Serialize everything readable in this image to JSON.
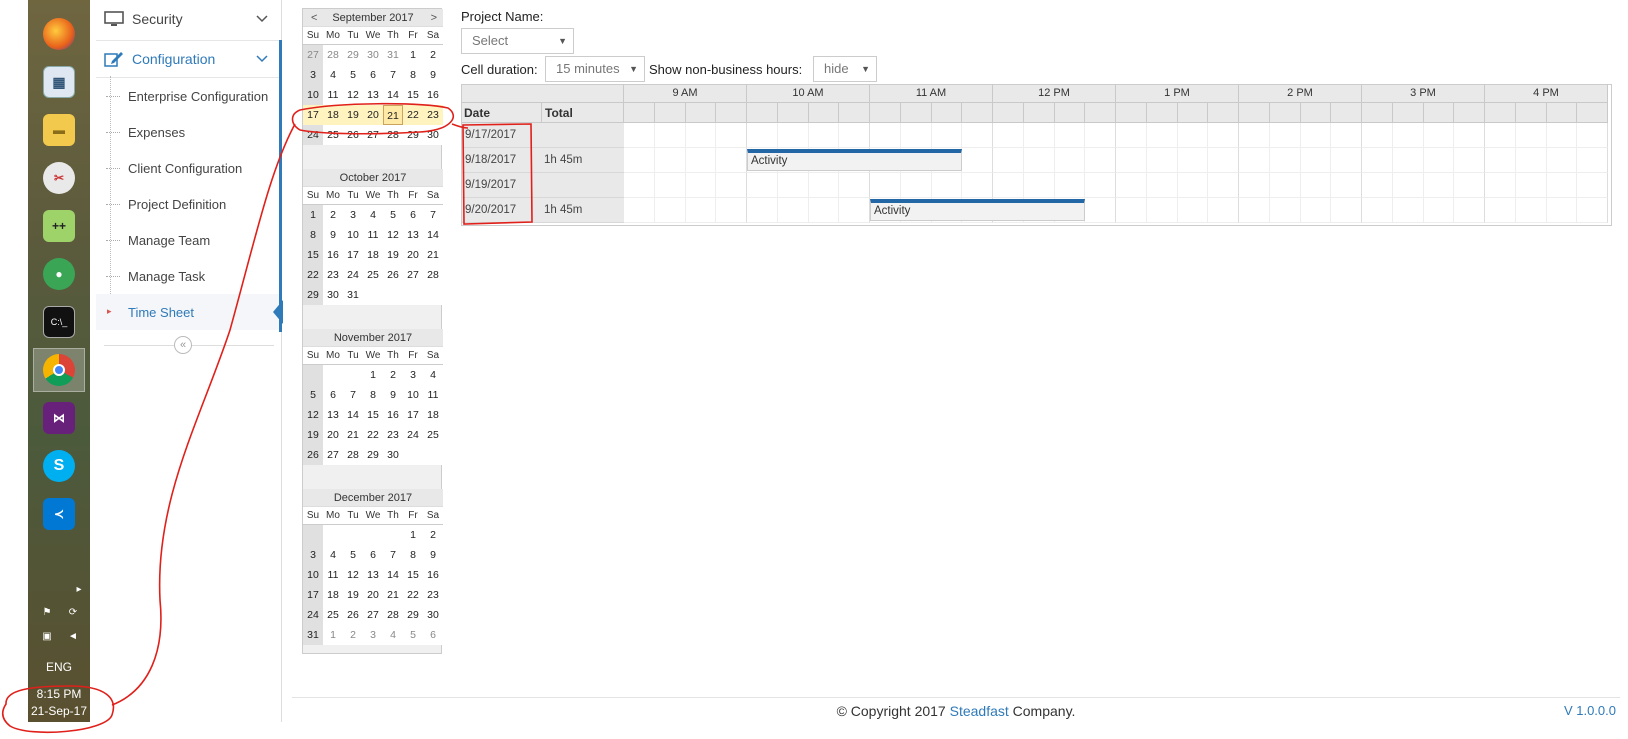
{
  "taskbar": {
    "apps": [
      {
        "icon": "firefox-icon",
        "label": ""
      },
      {
        "icon": "calculator-icon",
        "label": ""
      },
      {
        "icon": "file-explorer-icon",
        "label": ""
      },
      {
        "icon": "snipping-tool-icon",
        "label": ""
      },
      {
        "icon": "notepad-plus-plus-icon",
        "label": ""
      },
      {
        "icon": "green-app-icon",
        "label": ""
      },
      {
        "icon": "command-prompt-icon",
        "label": "C:\\_"
      },
      {
        "icon": "chrome-icon",
        "label": ""
      },
      {
        "icon": "visual-studio-icon",
        "label": ""
      },
      {
        "icon": "skype-icon",
        "label": "S"
      },
      {
        "icon": "vscode-icon",
        "label": ""
      }
    ],
    "language": "ENG",
    "time": "8:15 PM",
    "date": "21-Sep-17"
  },
  "sidebar": {
    "security": "Security",
    "configuration": "Configuration",
    "items": [
      "Enterprise Configuration",
      "Expenses",
      "Client Configuration",
      "Project Definition",
      "Manage Team",
      "Manage Task",
      "Time Sheet"
    ],
    "collapse_icon": "«"
  },
  "calendar": {
    "prev": "<",
    "next": ">",
    "dow": [
      "Su",
      "Mo",
      "Tu",
      "We",
      "Th",
      "Fr",
      "Sa"
    ],
    "months": [
      {
        "title": "September 2017",
        "weeks": [
          [
            "27",
            "28",
            "29",
            "30",
            "31",
            "1",
            "2"
          ],
          [
            "3",
            "4",
            "5",
            "6",
            "7",
            "8",
            "9"
          ],
          [
            "10",
            "11",
            "12",
            "13",
            "14",
            "15",
            "16"
          ],
          [
            "17",
            "18",
            "19",
            "20",
            "21",
            "22",
            "23"
          ],
          [
            "24",
            "25",
            "26",
            "27",
            "28",
            "29",
            "30"
          ]
        ]
      },
      {
        "title": "October 2017",
        "weeks": [
          [
            "1",
            "2",
            "3",
            "4",
            "5",
            "6",
            "7"
          ],
          [
            "8",
            "9",
            "10",
            "11",
            "12",
            "13",
            "14"
          ],
          [
            "15",
            "16",
            "17",
            "18",
            "19",
            "20",
            "21"
          ],
          [
            "22",
            "23",
            "24",
            "25",
            "26",
            "27",
            "28"
          ],
          [
            "29",
            "30",
            "31",
            "",
            "",
            "",
            ""
          ]
        ]
      },
      {
        "title": "November 2017",
        "weeks": [
          [
            "",
            "",
            "",
            "1",
            "2",
            "3",
            "4"
          ],
          [
            "5",
            "6",
            "7",
            "8",
            "9",
            "10",
            "11"
          ],
          [
            "12",
            "13",
            "14",
            "15",
            "16",
            "17",
            "18"
          ],
          [
            "19",
            "20",
            "21",
            "22",
            "23",
            "24",
            "25"
          ],
          [
            "26",
            "27",
            "28",
            "29",
            "30",
            "",
            ""
          ]
        ]
      },
      {
        "title": "December 2017",
        "weeks": [
          [
            "",
            "",
            "",
            "",
            "",
            "1",
            "2"
          ],
          [
            "3",
            "4",
            "5",
            "6",
            "7",
            "8",
            "9"
          ],
          [
            "10",
            "11",
            "12",
            "13",
            "14",
            "15",
            "16"
          ],
          [
            "17",
            "18",
            "19",
            "20",
            "21",
            "22",
            "23"
          ],
          [
            "24",
            "25",
            "26",
            "27",
            "28",
            "29",
            "30"
          ],
          [
            "31",
            "1",
            "2",
            "3",
            "4",
            "5",
            "6"
          ]
        ]
      }
    ]
  },
  "form": {
    "project_label": "Project Name:",
    "project_value": "Select",
    "cell_duration_label": "Cell duration:",
    "cell_duration_value": "15 minutes",
    "nonbusiness_label": "Show non-business hours:",
    "nonbusiness_value": "hide"
  },
  "scheduler": {
    "date_header": "Date",
    "total_header": "Total",
    "hours": [
      "9 AM",
      "10 AM",
      "11 AM",
      "12 PM",
      "1 PM",
      "2 PM",
      "3 PM",
      "4 PM"
    ],
    "rows": [
      {
        "date": "9/17/2017",
        "total": ""
      },
      {
        "date": "9/18/2017",
        "total": "1h 45m"
      },
      {
        "date": "9/19/2017",
        "total": ""
      },
      {
        "date": "9/20/2017",
        "total": "1h 45m"
      }
    ],
    "events": [
      {
        "label": "Activity",
        "row": 1,
        "start": "10:00",
        "end": "11:45"
      },
      {
        "label": "Activity",
        "row": 3,
        "start": "11:00",
        "end": "12:45"
      }
    ]
  },
  "footer": {
    "copy_prefix": "© Copyright 2017 ",
    "company": "Steadfast",
    "copy_suffix": " Company.",
    "version": "V 1.0.0.0"
  }
}
